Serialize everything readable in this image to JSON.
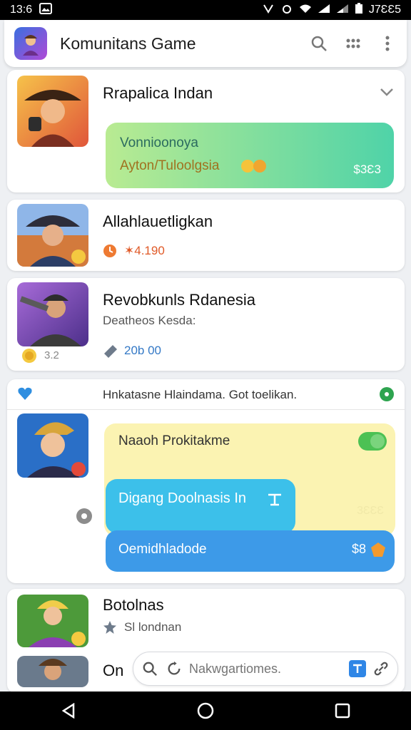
{
  "status_bar": {
    "time": "13:6",
    "right_text": "J7ƐƐ5"
  },
  "app_bar": {
    "title": "Komunitans Game"
  },
  "cards": [
    {
      "title": "Rrapalica Indan",
      "bubble_line1": "Vonnioonoya",
      "bubble_line2": "Ayton/Tuloolgsia",
      "bubble_amount": "$3Ɛ3"
    },
    {
      "title": "Allahlauetligkan",
      "meta": "✶4.190"
    },
    {
      "title": "Revobkunls Rdanesia",
      "subtitle": "Deatheos Kesda:",
      "badge_count": "3.2",
      "meta": "20b 00"
    },
    {
      "header_text": "Hnkatasne Hlaindama.  Got toelikan.",
      "bubble_top": "Naaoh Prokitakme",
      "bubble_mid": "Digang Doolnasis In",
      "bubble_mid_amount": "3ƐƐƐ",
      "bubble_bottom": "Oemidhladode",
      "bubble_bottom_amount": "$8"
    },
    {
      "title": "Botolnas",
      "subtitle": "Sl londnan"
    },
    {
      "title": "On"
    }
  ],
  "search": {
    "placeholder": "Nakwgartiomes."
  },
  "colors": {
    "accent_green": "#4fd3a8",
    "accent_blue": "#3d9ae8",
    "yellow_bubble": "#fbf3b2",
    "cyan_bubble": "#3cc0ea"
  }
}
